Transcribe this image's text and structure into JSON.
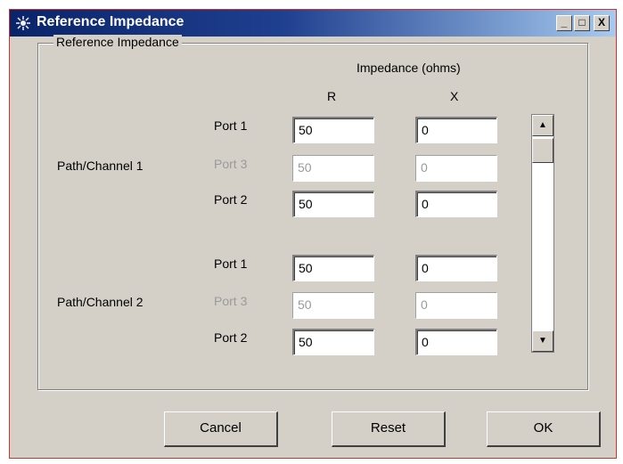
{
  "window": {
    "title": "Reference Impedance",
    "minimize_glyph": "_",
    "maximize_glyph": "□",
    "close_glyph": "X"
  },
  "group": {
    "legend": "Reference Impedance",
    "column_header": "Impedance (ohms)",
    "col_r": "R",
    "col_x": "X"
  },
  "channels": [
    {
      "label": "Path/Channel 1",
      "ports": [
        {
          "label": "Port 1",
          "r": "50",
          "x": "0",
          "enabled": true
        },
        {
          "label": "Port 3",
          "r": "50",
          "x": "0",
          "enabled": false
        },
        {
          "label": "Port 2",
          "r": "50",
          "x": "0",
          "enabled": true
        }
      ]
    },
    {
      "label": "Path/Channel 2",
      "ports": [
        {
          "label": "Port 1",
          "r": "50",
          "x": "0",
          "enabled": true
        },
        {
          "label": "Port 3",
          "r": "50",
          "x": "0",
          "enabled": false
        },
        {
          "label": "Port 2",
          "r": "50",
          "x": "0",
          "enabled": true
        }
      ]
    }
  ],
  "scrollbar": {
    "up_glyph": "▲",
    "down_glyph": "▼"
  },
  "buttons": {
    "cancel": "Cancel",
    "reset": "Reset",
    "ok": "OK"
  },
  "colors": {
    "titlebar_start": "#0a246a",
    "titlebar_end": "#a6caf0",
    "face": "#d4d0c8",
    "disabled_text": "#9a9a9a"
  }
}
